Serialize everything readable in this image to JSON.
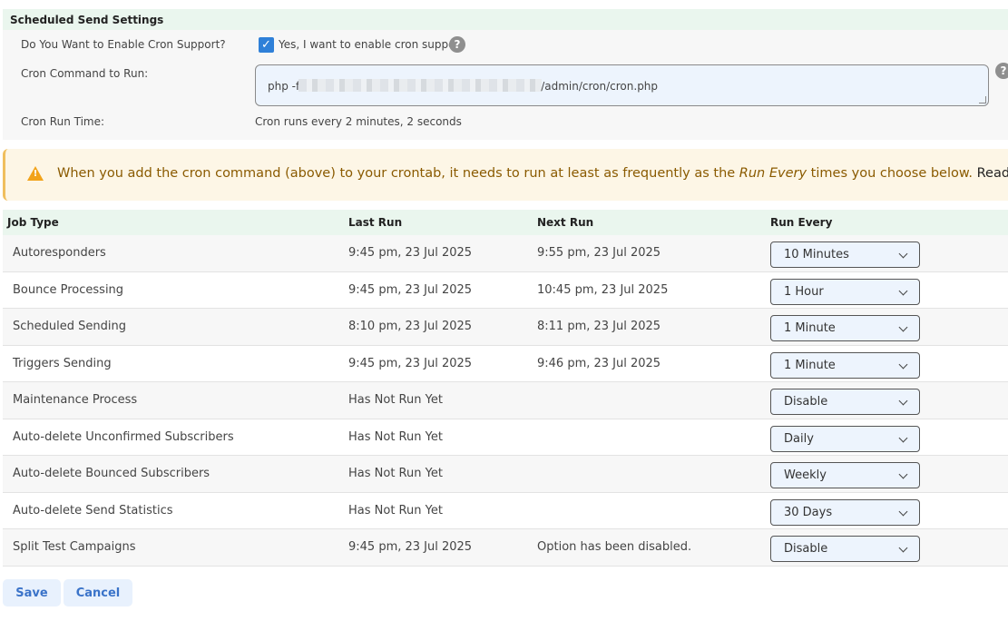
{
  "section": {
    "title": "Scheduled Send Settings"
  },
  "settings": {
    "enable_label": "Do You Want to Enable Cron Support?",
    "enable_checkbox_label": "Yes, I want to enable cron support",
    "enable_checked": true,
    "command_label": "Cron Command to Run:",
    "command_prefix": "php -f",
    "command_suffix": "/admin/cron/cron.php",
    "runtime_label": "Cron Run Time:",
    "runtime_value": "Cron runs every 2 minutes, 2 seconds",
    "help_glyph": "?"
  },
  "warning": {
    "icon": "warning-icon",
    "text_before": "When you add the cron command (above) to your crontab, it needs to run at least as frequently as the ",
    "text_em": "Run Every",
    "text_after": " times you choose below. ",
    "read_more": "Read More"
  },
  "table": {
    "headers": [
      "Job Type",
      "Last Run",
      "Next Run",
      "Run Every"
    ],
    "rows": [
      {
        "job": "Autoresponders",
        "last": "9:45 pm, 23 Jul 2025",
        "next": "9:55 pm, 23 Jul 2025",
        "every": "10 Minutes"
      },
      {
        "job": "Bounce Processing",
        "last": "9:45 pm, 23 Jul 2025",
        "next": "10:45 pm, 23 Jul 2025",
        "every": "1 Hour"
      },
      {
        "job": "Scheduled Sending",
        "last": "8:10 pm, 23 Jul 2025",
        "next": "8:11 pm, 23 Jul 2025",
        "every": "1 Minute"
      },
      {
        "job": "Triggers Sending",
        "last": "9:45 pm, 23 Jul 2025",
        "next": "9:46 pm, 23 Jul 2025",
        "every": "1 Minute"
      },
      {
        "job": "Maintenance Process",
        "last": "Has Not Run Yet",
        "next": "",
        "every": "Disable"
      },
      {
        "job": "Auto-delete Unconfirmed Subscribers",
        "last": "Has Not Run Yet",
        "next": "",
        "every": "Daily"
      },
      {
        "job": "Auto-delete Bounced Subscribers",
        "last": "Has Not Run Yet",
        "next": "",
        "every": "Weekly"
      },
      {
        "job": "Auto-delete Send Statistics",
        "last": "Has Not Run Yet",
        "next": "",
        "every": "30 Days"
      },
      {
        "job": "Split Test Campaigns",
        "last": "9:45 pm, 23 Jul 2025",
        "next": "Option has been disabled.",
        "every": "Disable"
      }
    ]
  },
  "buttons": {
    "save": "Save",
    "cancel": "Cancel"
  },
  "colors": {
    "accent": "#2f80d8",
    "header_bg": "#eaf6ee",
    "warning_text": "#8a5a00",
    "warning_border": "#f0bf5e",
    "button_text": "#3a73c9"
  }
}
